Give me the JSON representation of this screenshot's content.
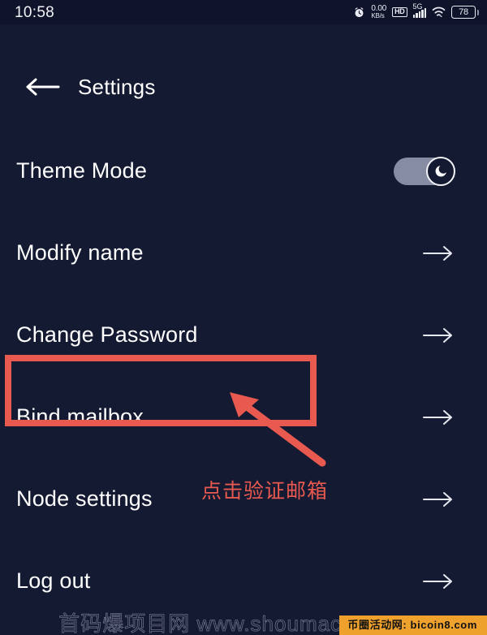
{
  "status_bar": {
    "time": "10:58",
    "alarm_icon": "alarm-clock-icon",
    "net_speed_rate": "0.00",
    "net_speed_unit": "KB/s",
    "hd_badge": "HD",
    "network_type": "5G",
    "signal_bars": 5,
    "wifi_icon": "wifi-icon",
    "battery_level": "78"
  },
  "app_bar": {
    "back_icon": "back-arrow-icon",
    "title": "Settings"
  },
  "settings": {
    "rows": [
      {
        "label": "Theme Mode",
        "control": "toggle",
        "toggle_on": true,
        "icon": "moon-icon"
      },
      {
        "label": "Modify name",
        "control": "arrow",
        "icon": "arrow-right-icon"
      },
      {
        "label": "Change Password",
        "control": "arrow",
        "icon": "arrow-right-icon"
      },
      {
        "label": "Bind mailbox",
        "control": "arrow",
        "icon": "arrow-right-icon",
        "highlighted": true
      },
      {
        "label": "Node settings",
        "control": "arrow",
        "icon": "arrow-right-icon"
      },
      {
        "label": "Log out",
        "control": "arrow",
        "icon": "arrow-right-icon"
      }
    ]
  },
  "annotation": {
    "text": "点击验证邮箱",
    "color": "#e8594f",
    "arrow_icon": "annotation-arrow-icon",
    "box_icon": "highlight-box"
  },
  "watermark": {
    "text": "首码爆项目网 www.shoumacuan.com",
    "badge": "币圈活动网: bicoin8.com",
    "badge_color": "#efa12e"
  },
  "theme": {
    "background": "#151a33",
    "status_bar_bg": "#10142b",
    "text": "#ffffff",
    "toggle_track": "#868da3"
  }
}
